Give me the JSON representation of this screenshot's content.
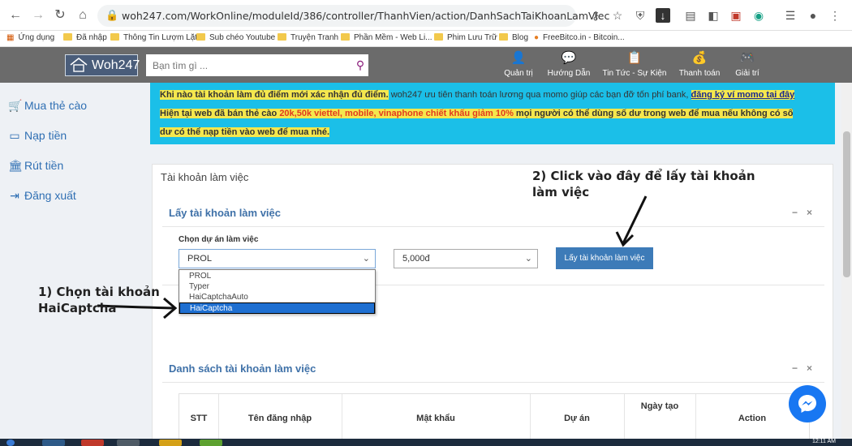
{
  "browser": {
    "url": "woh247.com/WorkOnline/moduleId/386/controller/ThanhVien/action/DanhSachTaiKhoanLamViec",
    "bookmarks": [
      "Ứng dụng",
      "Đã nhập",
      "Thông Tin Lượm Lặt",
      "Sub chéo Youtube",
      "Truyện Tranh",
      "Phần Mềm - Web Li...",
      "Phim Lưu Trữ",
      "Blog",
      "FreeBitco.in - Bitcoin..."
    ]
  },
  "header": {
    "logo_text": "Woh247",
    "search_placeholder": "Bạn tìm gì ...",
    "nav": [
      {
        "label": "Quản trị",
        "icon": "user-icon"
      },
      {
        "label": "Hướng Dẫn",
        "icon": "chat-icon"
      },
      {
        "label": "Tin Tức - Sự Kiện",
        "icon": "news-icon"
      },
      {
        "label": "Thanh toán",
        "icon": "payment-icon"
      },
      {
        "label": "Giải trí",
        "icon": "game-icon"
      }
    ]
  },
  "sidebar": {
    "items": [
      {
        "label": "Mua thẻ cào",
        "icon": "cart-icon"
      },
      {
        "label": "Nạp tiền",
        "icon": "card-icon"
      },
      {
        "label": "Rút tiền",
        "icon": "bank-icon"
      },
      {
        "label": "Đăng xuất",
        "icon": "logout-icon"
      }
    ]
  },
  "notice": {
    "line1_hl": "Khi nào tài khoản làm đủ điểm mới xác nhận đủ điểm.",
    "line1_rest": " woh247 ưu tiên thanh toán lương qua momo giúp các bạn đỡ tốn phí bank,",
    "line1_link": "đăng ký ví momo tại đây",
    "line2_a": "Hiện tại web đã bán thẻ cào ",
    "line2_orange": "20k,50k viettel, mobile, vinaphone chiết khấu giảm 10%",
    "line2_b": " mọi người có thể dùng số dư trong web để mua nếu không có số",
    "line3": "dư có thể nạp tiền vào web để mua nhé."
  },
  "panel": {
    "title": "Tài khoản làm việc",
    "sub_title": "Lấy tài khoản làm việc",
    "field_label": "Chọn dự án làm việc",
    "project_selected": "PROL",
    "amount_selected": "5,000đ",
    "dropdown_options": [
      "PROL",
      "Typer",
      "HaiCaptchaAuto",
      "HaiCaptcha"
    ],
    "get_button": "Lấy tài khoản làm việc",
    "list_title": "Danh sách tài khoản làm việc",
    "tool_min": "−",
    "tool_close": "×",
    "table_headers": [
      "STT",
      "Tên đăng nhập",
      "Mật khẩu",
      "Dự án",
      "Ngày tạo",
      "Action"
    ]
  },
  "annotations": {
    "step1": [
      "1) Chọn tài khoản",
      "HaiCaptcha"
    ],
    "step2": [
      "2) Click vào đây để lấy tài khoản",
      "làm việc"
    ]
  },
  "taskbar": {
    "time": "12:11 AM"
  }
}
